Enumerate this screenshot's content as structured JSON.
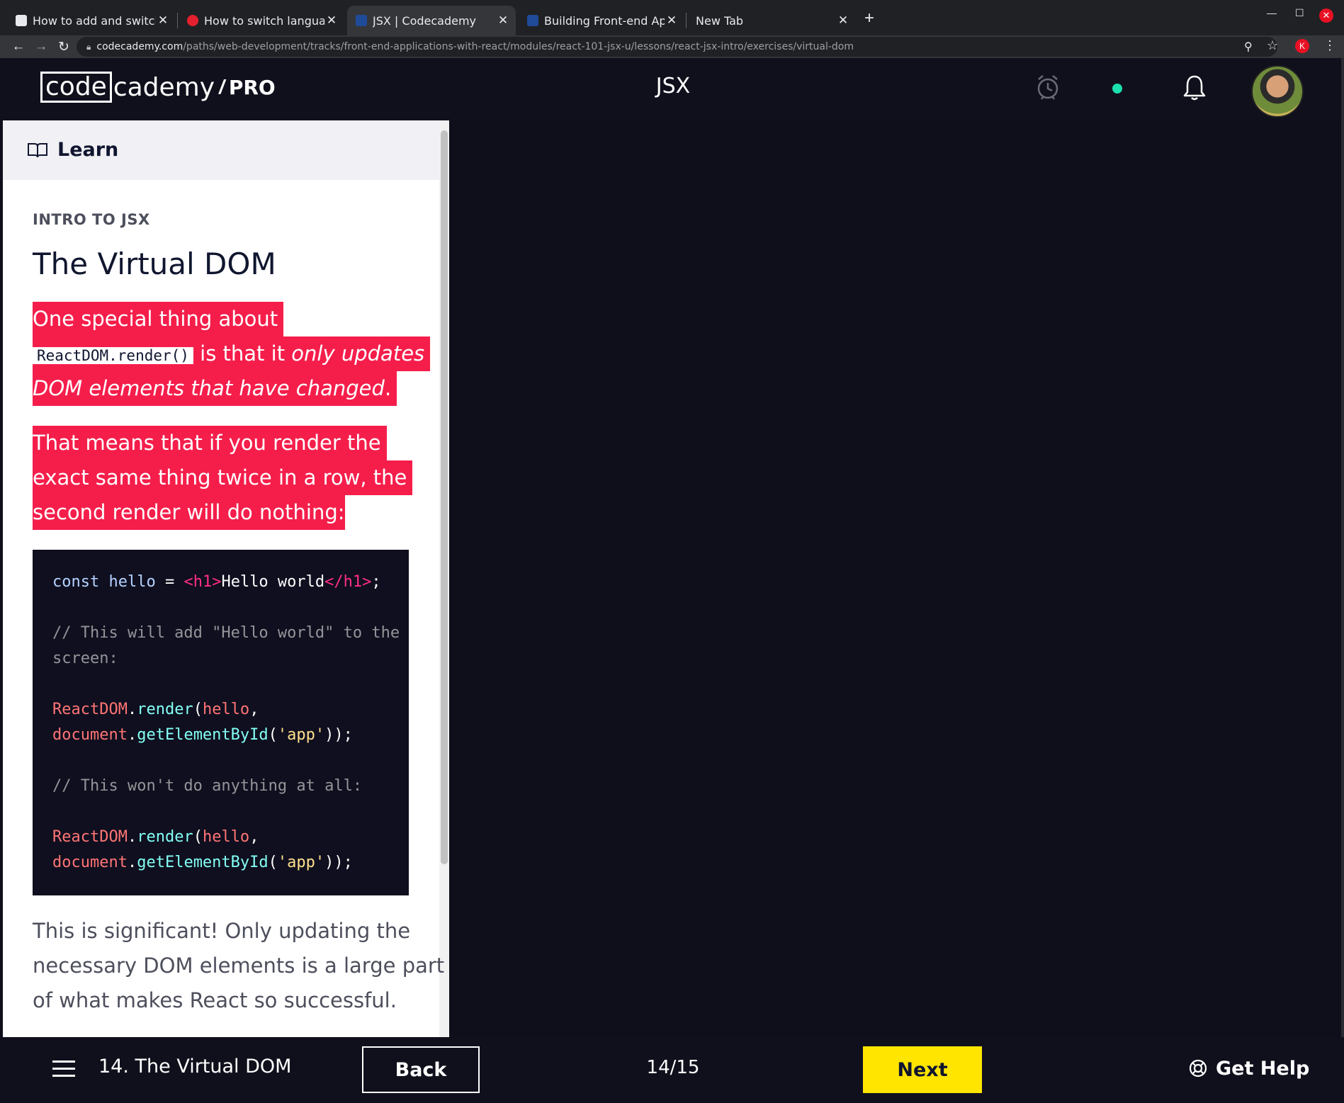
{
  "browser": {
    "tabs": [
      {
        "title": "How to add and switch ke",
        "active": false
      },
      {
        "title": "How to switch language k",
        "active": false
      },
      {
        "title": "JSX | Codecademy",
        "active": true
      },
      {
        "title": "Building Front-end Applic",
        "active": false
      },
      {
        "title": "New Tab",
        "active": false
      }
    ],
    "url_host": "codecademy.com",
    "url_path": "/paths/web-development/tracks/front-end-applications-with-react/modules/react-101-jsx-u/lessons/react-jsx-intro/exercises/virtual-dom",
    "profile_initial": "K"
  },
  "header": {
    "logo_code": "code",
    "logo_rest": "cademy",
    "logo_slash": "/",
    "logo_pro": "PRO",
    "course_title": "JSX"
  },
  "learn": {
    "label": "Learn"
  },
  "lesson": {
    "eyebrow": "INTRO TO JSX",
    "title": "The Virtual DOM",
    "p1_line1": "One special thing about",
    "p1_code": "ReactDOM.render()",
    "p1_line2_rest": " is that it ",
    "p1_line2_em": "only updates",
    "p1_line3_em": "DOM elements that have changed",
    "p1_line3_end": ".",
    "p2_line1": "That means that if you render the",
    "p2_line2": "exact same thing twice in a row, the",
    "p2_line3": "second render will do nothing:",
    "code": {
      "l1_kw": "const",
      "l1_var": " hello",
      "l1_op": " = ",
      "l1_tag_open": "<h1>",
      "l1_txt": "Hello world",
      "l1_tag_close": "</h1>",
      "l1_end": ";",
      "l2": "// This will add \"Hello world\" to the",
      "l3": "screen:",
      "l4_obj": "ReactDOM",
      "l4_dot": ".",
      "l4_fn": "render",
      "l4_paren": "(",
      "l4_arg": "hello",
      "l4_comma": ",",
      "l5_obj": "document",
      "l5_dot": ".",
      "l5_fn": "getElementById",
      "l5_paren": "(",
      "l5_str": "'app'",
      "l5_end": "));",
      "l6": "// This won't do anything at all:",
      "l7_obj": "ReactDOM",
      "l7_dot": ".",
      "l7_fn": "render",
      "l7_paren": "(",
      "l7_arg": "hello",
      "l7_comma": ",",
      "l8_obj": "document",
      "l8_dot": ".",
      "l8_fn": "getElementById",
      "l8_paren": "(",
      "l8_str": "'app'",
      "l8_end": "));"
    },
    "p3_line1": "This is significant! Only updating the",
    "p3_line2": "necessary DOM elements is a large part",
    "p3_line3": "of what makes React so successful."
  },
  "footer": {
    "lesson_label": "14. The Virtual DOM",
    "back_label": "Back",
    "progress": "14/15",
    "next_label": "Next",
    "help_label": "Get Help"
  },
  "colors": {
    "highlight": "#f51e4b",
    "next_button": "#ffe500",
    "app_background": "#10101d",
    "code_background": "#0f0f1f"
  }
}
